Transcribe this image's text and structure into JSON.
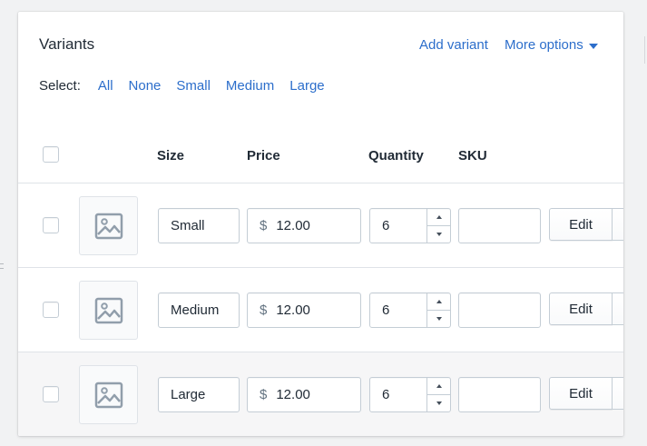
{
  "card": {
    "title": "Variants",
    "add_variant": "Add variant",
    "more_options": "More options"
  },
  "select": {
    "label": "Select:",
    "options": [
      "All",
      "None",
      "Small",
      "Medium",
      "Large"
    ]
  },
  "columns": {
    "size": "Size",
    "price": "Price",
    "quantity": "Quantity",
    "sku": "SKU"
  },
  "variants": [
    {
      "size": "Small",
      "currency": "$",
      "price": "12.00",
      "quantity": "6",
      "sku": "",
      "edit": "Edit"
    },
    {
      "size": "Medium",
      "currency": "$",
      "price": "12.00",
      "quantity": "6",
      "sku": "",
      "edit": "Edit"
    },
    {
      "size": "Large",
      "currency": "$",
      "price": "12.00",
      "quantity": "6",
      "sku": "",
      "edit": "Edit"
    }
  ],
  "colors": {
    "link": "#2c6ecb",
    "text": "#212b36",
    "border": "#c4cdd5",
    "divider": "#dfe3e8",
    "page_bg": "#f1f2f3"
  },
  "icons": {
    "thumbnail": "image-placeholder-icon",
    "dropdown": "caret-down-icon",
    "stepper_up": "chevron-up-icon",
    "stepper_down": "chevron-down-icon"
  }
}
